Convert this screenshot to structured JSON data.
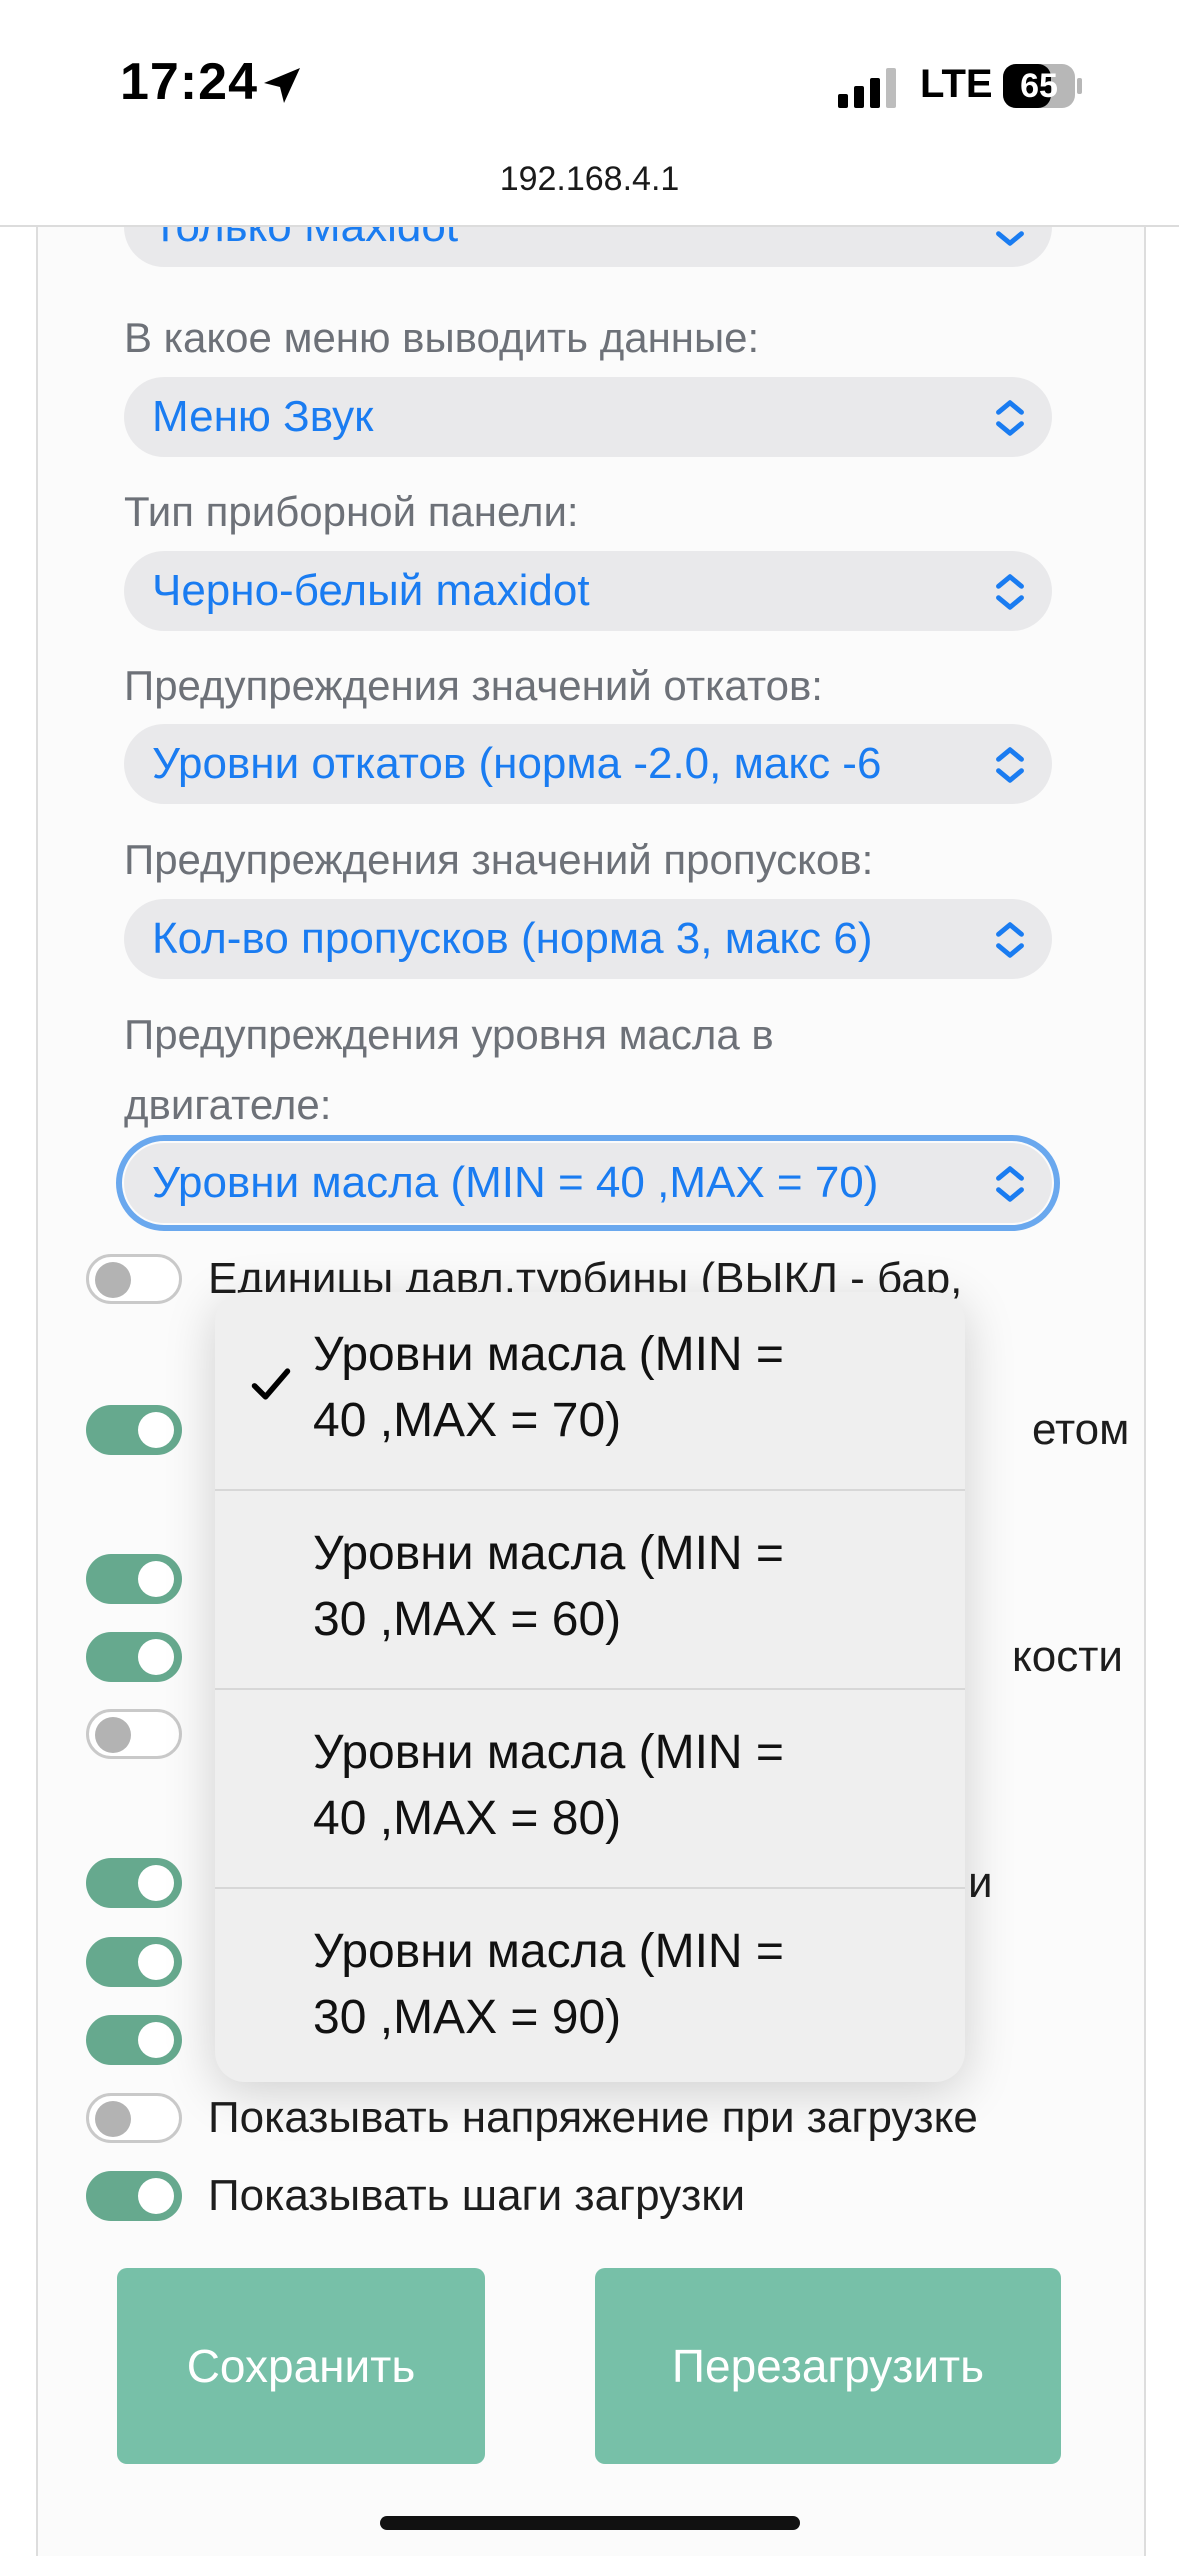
{
  "status_bar": {
    "time": "17:24",
    "network": "LTE",
    "battery": "65"
  },
  "browser": {
    "url": "192.168.4.1"
  },
  "form": {
    "top_select": {
      "value": "Только Maxidot"
    },
    "fields": [
      {
        "label": "В какое меню выводить данные:",
        "value": "Меню Звук"
      },
      {
        "label": "Тип приборной панели:",
        "value": "Черно-белый maxidot"
      },
      {
        "label": "Предупреждения значений откатов:",
        "value": "Уровни откатов (норма -2.0, макс -6"
      },
      {
        "label": "Предупреждения значений пропусков:",
        "value": "Кол-во пропусков (норма 3, макс 6)"
      }
    ],
    "oil": {
      "label_line1": "Предупреждения уровня масла в",
      "label_line2": "двигателе:",
      "value": "Уровни масла (MIN = 40 ,MAX = 70)"
    }
  },
  "toggles": [
    {
      "text": "Единицы давл.турбины (ВЫКЛ - бар,",
      "state": "off"
    },
    {
      "text": "",
      "state": "on",
      "peek": "етом"
    },
    {
      "text": "",
      "state": "on"
    },
    {
      "text": "",
      "state": "on",
      "peek": "кости"
    },
    {
      "text": "",
      "state": "off"
    },
    {
      "text": "",
      "state": "on",
      "peek": "и"
    },
    {
      "text": "",
      "state": "on"
    },
    {
      "text": "",
      "state": "on"
    },
    {
      "text": "Показывать напряжение при загрузке",
      "state": "off"
    },
    {
      "text": "Показывать шаги загрузки",
      "state": "on"
    }
  ],
  "buttons": {
    "save": "Сохранить",
    "reboot": "Перезагрузить"
  },
  "dropdown": {
    "options": [
      {
        "line1": "Уровни масла (MIN =",
        "line2": "40 ,MAX = 70)",
        "selected": true
      },
      {
        "line1": "Уровни масла (MIN =",
        "line2": "30 ,MAX = 60)",
        "selected": false
      },
      {
        "line1": "Уровни масла (MIN =",
        "line2": "40 ,MAX = 80)",
        "selected": false
      },
      {
        "line1": "Уровни масла (MIN =",
        "line2": "30 ,MAX = 90)",
        "selected": false
      }
    ]
  },
  "colors": {
    "accent_blue": "#1a7cf1",
    "toggle_on": "#66a98e",
    "button": "#77c0a8",
    "focus_ring": "#6aa8ee"
  }
}
